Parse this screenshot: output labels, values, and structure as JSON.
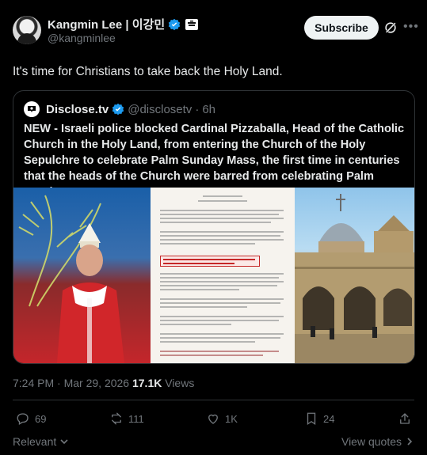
{
  "author": {
    "display_name": "Kangmin Lee | 이강민",
    "handle": "@kangminlee"
  },
  "header": {
    "subscribe_label": "Subscribe",
    "grok_icon": "grok-icon",
    "more_icon": "more-horizontal-icon"
  },
  "post": {
    "text": "It's time for Christians to take back the Holy Land."
  },
  "quote": {
    "name": "Disclose.tv",
    "handle": "@disclosetv",
    "dot": "·",
    "time": "6h",
    "text": "NEW - Israeli police blocked Cardinal Pizzaballa, Head of the Catholic Church in the Holy Land, from entering the Church of the Holy Sepulchre to celebrate Palm Sunday Mass, the first time in centuries that the heads of the Church were barred from celebrating Palm Sunday Mass at"
  },
  "meta": {
    "time": "7:24 PM",
    "dot": " · ",
    "date": "Mar 29, 2026",
    "views_count": "17.1K",
    "views_label": "Views"
  },
  "actions": {
    "replies": "69",
    "reposts": "111",
    "likes": "1K",
    "bookmarks": "24"
  },
  "footer": {
    "sort_label": "Relevant",
    "view_quotes_label": "View quotes"
  },
  "colors": {
    "background": "#000000",
    "text": "#e7e9ea",
    "secondary": "#71767b",
    "border": "#2f3336",
    "verified": "#1d9bf0"
  }
}
